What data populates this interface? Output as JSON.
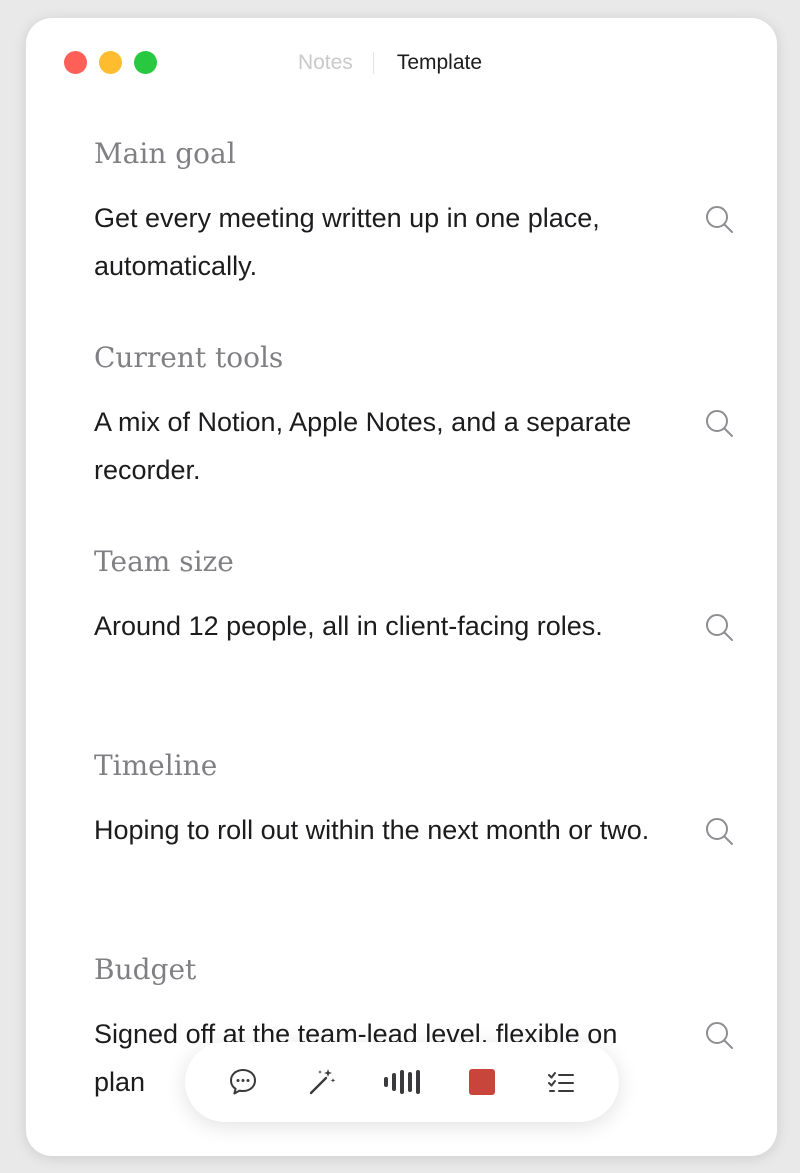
{
  "window": {
    "tabs": {
      "inactive": "Notes",
      "active": "Template"
    }
  },
  "sections": [
    {
      "heading": "Main goal",
      "text": "Get every meeting written up in one place, automatically."
    },
    {
      "heading": "Current tools",
      "text": "A mix of Notion, Apple Notes, and a separate recorder."
    },
    {
      "heading": "Team size",
      "text": "Around 12 people, all in client-facing roles."
    },
    {
      "heading": "Timeline",
      "text": "Hoping to roll out within the next month or two."
    },
    {
      "heading": "Budget",
      "text": "Signed off at the team-lead level, flexible on plan"
    }
  ],
  "toolbar": {
    "items": [
      "chat-icon",
      "magic-wand-icon",
      "audio-levels-icon",
      "stop-icon",
      "checklist-icon"
    ],
    "stop_color": "#c9453b"
  },
  "colors": {
    "close": "#fe5f57",
    "minimize": "#febc2e",
    "maximize": "#28c840"
  }
}
